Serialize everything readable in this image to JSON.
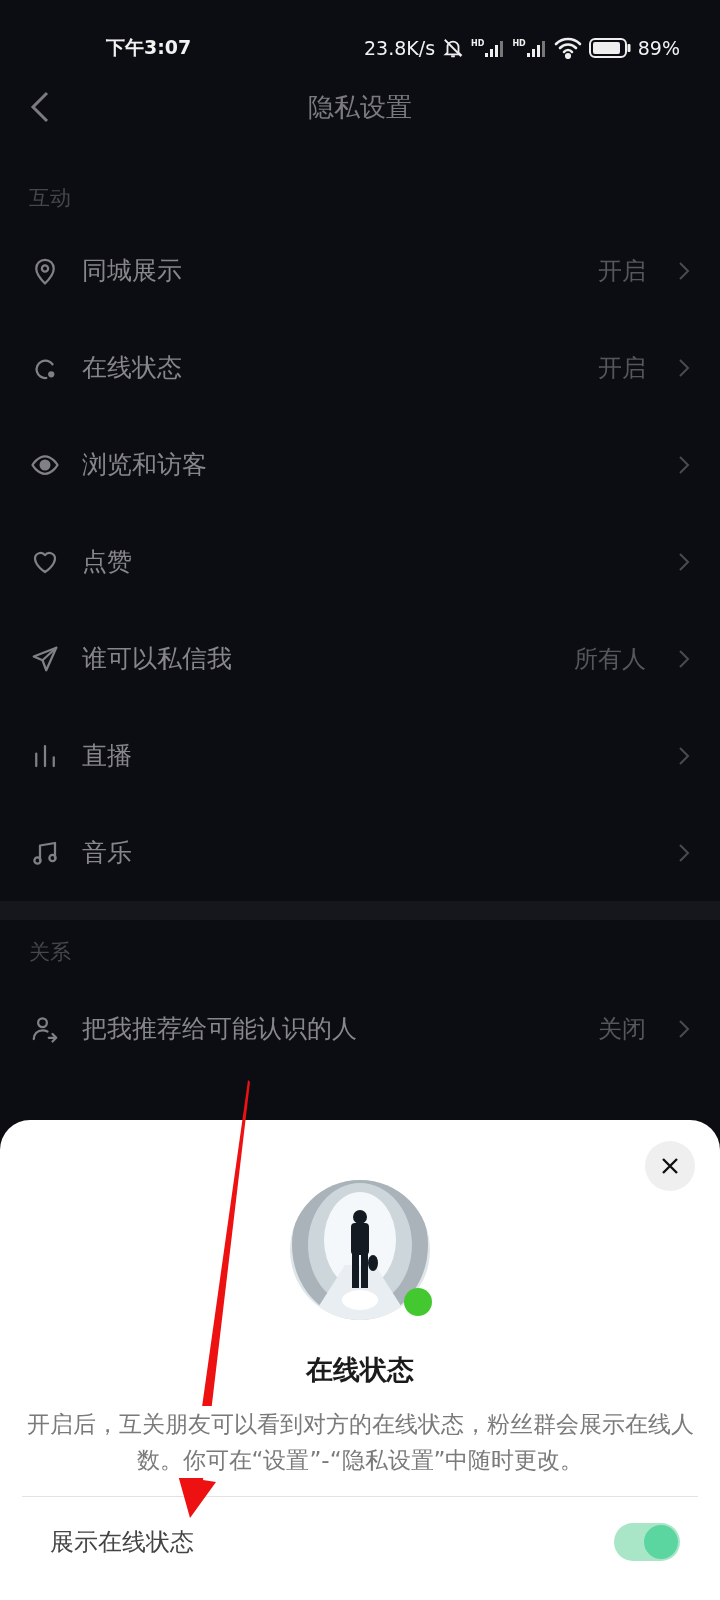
{
  "status_bar": {
    "time": "下午3:07",
    "net_speed": "23.8K/s",
    "signals": [
      {
        "label": "HD"
      },
      {
        "label": "HD"
      }
    ],
    "battery": "89%"
  },
  "header": {
    "title": "隐私设置"
  },
  "sections": [
    {
      "title": "互动",
      "items": [
        {
          "kind": "pin",
          "label": "同城展示",
          "value": "开启"
        },
        {
          "kind": "status",
          "label": "在线状态",
          "value": "开启"
        },
        {
          "kind": "eye",
          "label": "浏览和访客"
        },
        {
          "kind": "heart",
          "label": "点赞"
        },
        {
          "kind": "send",
          "label": "谁可以私信我",
          "value": "所有人"
        },
        {
          "kind": "bars",
          "label": "直播"
        },
        {
          "kind": "music",
          "label": "音乐"
        }
      ]
    },
    {
      "title": "关系",
      "items": [
        {
          "kind": "user",
          "label": "把我推荐给可能认识的人",
          "value": "关闭"
        }
      ]
    }
  ],
  "sheet": {
    "online": true,
    "title": "在线状态",
    "description": "开启后，互关朋友可以看到对方的在线状态，粉丝群会展示在线人数。你可在“设置”-“隐私设置”中随时更改。",
    "toggle": {
      "label": "展示在线状态",
      "on": true
    }
  }
}
